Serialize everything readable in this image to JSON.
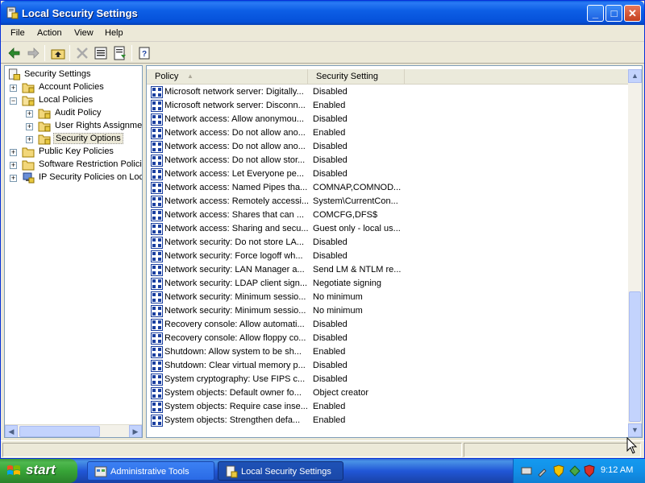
{
  "window": {
    "title": "Local Security Settings",
    "menu": [
      "File",
      "Action",
      "View",
      "Help"
    ]
  },
  "tree": {
    "items": [
      {
        "label": "Security Settings",
        "icon": "security-settings-icon",
        "expander": ""
      },
      {
        "label": "Account Policies",
        "icon": "folder-icon",
        "expander": "+"
      },
      {
        "label": "Local Policies",
        "icon": "folder-open-icon",
        "expander": "−"
      },
      {
        "label": "Audit Policy",
        "icon": "folder-icon",
        "expander": "+"
      },
      {
        "label": "User Rights Assignment",
        "icon": "folder-icon",
        "expander": "+"
      },
      {
        "label": "Security Options",
        "icon": "folder-icon",
        "expander": "+",
        "selected": true
      },
      {
        "label": "Public Key Policies",
        "icon": "folder-icon",
        "expander": "+"
      },
      {
        "label": "Software Restriction Policies",
        "icon": "folder-icon",
        "expander": "+"
      },
      {
        "label": "IP Security Policies on Local Computer",
        "icon": "ip-security-icon",
        "expander": "+"
      }
    ]
  },
  "list": {
    "columns": {
      "policy": "Policy",
      "setting": "Security Setting"
    },
    "rows": [
      {
        "policy": "Microsoft network server: Digitally...",
        "setting": "Disabled"
      },
      {
        "policy": "Microsoft network server: Disconn...",
        "setting": "Enabled"
      },
      {
        "policy": "Network access: Allow anonymou...",
        "setting": "Disabled"
      },
      {
        "policy": "Network access: Do not allow ano...",
        "setting": "Enabled"
      },
      {
        "policy": "Network access: Do not allow ano...",
        "setting": "Disabled"
      },
      {
        "policy": "Network access: Do not allow stor...",
        "setting": "Disabled"
      },
      {
        "policy": "Network access: Let Everyone pe...",
        "setting": "Disabled"
      },
      {
        "policy": "Network access: Named Pipes tha...",
        "setting": "COMNAP,COMNOD..."
      },
      {
        "policy": "Network access: Remotely accessi...",
        "setting": "System\\CurrentCon..."
      },
      {
        "policy": "Network access: Shares that can ...",
        "setting": "COMCFG,DFS$"
      },
      {
        "policy": "Network access: Sharing and secu...",
        "setting": "Guest only - local us..."
      },
      {
        "policy": "Network security: Do not store LA...",
        "setting": "Disabled"
      },
      {
        "policy": "Network security: Force logoff wh...",
        "setting": "Disabled"
      },
      {
        "policy": "Network security: LAN Manager a...",
        "setting": "Send LM & NTLM re..."
      },
      {
        "policy": "Network security: LDAP client sign...",
        "setting": "Negotiate signing"
      },
      {
        "policy": "Network security: Minimum sessio...",
        "setting": "No minimum"
      },
      {
        "policy": "Network security: Minimum sessio...",
        "setting": "No minimum"
      },
      {
        "policy": "Recovery console: Allow automati...",
        "setting": "Disabled"
      },
      {
        "policy": "Recovery console: Allow floppy co...",
        "setting": "Disabled"
      },
      {
        "policy": "Shutdown: Allow system to be sh...",
        "setting": "Enabled"
      },
      {
        "policy": "Shutdown: Clear virtual memory p...",
        "setting": "Disabled"
      },
      {
        "policy": "System cryptography: Use FIPS c...",
        "setting": "Disabled"
      },
      {
        "policy": "System objects: Default owner fo...",
        "setting": "Object creator"
      },
      {
        "policy": "System objects: Require case inse...",
        "setting": "Enabled"
      },
      {
        "policy": "System objects: Strengthen defa...",
        "setting": "Enabled"
      }
    ]
  },
  "taskbar": {
    "start_label": "start",
    "tasks": [
      {
        "label": "Administrative Tools",
        "active": false
      },
      {
        "label": "Local Security Settings",
        "active": true
      }
    ],
    "clock": "9:12 AM"
  },
  "colors": {
    "titlebar": "#0a5ce0",
    "taskbar": "#2157d7",
    "start": "#37a437",
    "tray": "#1290e8"
  }
}
